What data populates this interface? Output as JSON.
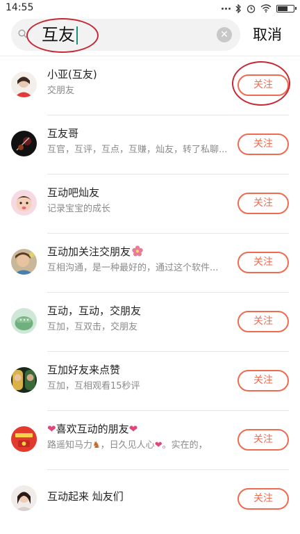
{
  "status_bar": {
    "time": "14:55"
  },
  "search": {
    "query": "互友",
    "cancel_label": "取消"
  },
  "results": [
    {
      "name": "小亚(互友)",
      "desc": "交朋友",
      "follow": "关注"
    },
    {
      "name": "互友哥",
      "desc": "互官，互评，互点，互赚，灿友，转了私聊...",
      "follow": "关注"
    },
    {
      "name": "互动吧灿友",
      "desc": "记录宝宝的成长",
      "follow": "关注"
    },
    {
      "name": "互动加关注交朋友",
      "desc": "互相沟通，是一种最好的，通过这个软件...",
      "follow": "关注"
    },
    {
      "name": "互动，互动，交朋友",
      "desc": "互加，互双击，交朋友",
      "follow": "关注"
    },
    {
      "name": "互加好友来点赞",
      "desc": "互加，互相观看15秒评",
      "follow": "关注"
    },
    {
      "name_mid": "喜欢互动的朋友",
      "desc_a": "路遥知马力",
      "desc_b": "，日久见人心",
      "desc_c": "。实在的，",
      "follow": "关注"
    },
    {
      "name": "互动起来 灿友们",
      "desc": "",
      "follow": "关注"
    }
  ],
  "colors": {
    "accent": "#f06a50",
    "annotation": "#c62835",
    "caret": "#1a8f7a"
  }
}
